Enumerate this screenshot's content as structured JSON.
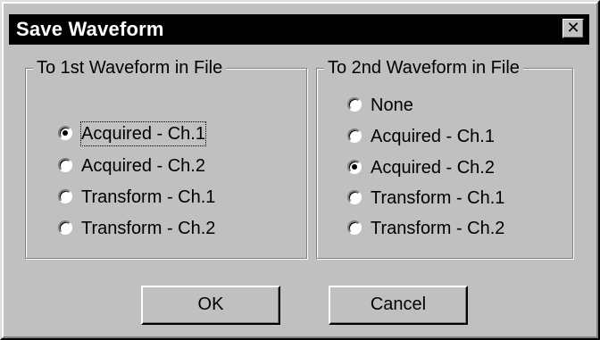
{
  "window": {
    "title": "Save Waveform",
    "close_glyph": "✕"
  },
  "group1": {
    "title": "To 1st Waveform in File",
    "options": [
      {
        "label": "Acquired - Ch.1",
        "checked": true,
        "focused": true
      },
      {
        "label": "Acquired - Ch.2",
        "checked": false
      },
      {
        "label": "Transform - Ch.1",
        "checked": false
      },
      {
        "label": "Transform - Ch.2",
        "checked": false
      }
    ]
  },
  "group2": {
    "title": "To 2nd Waveform in File",
    "options": [
      {
        "label": "None",
        "checked": false
      },
      {
        "label": "Acquired - Ch.1",
        "checked": false
      },
      {
        "label": "Acquired - Ch.2",
        "checked": true
      },
      {
        "label": "Transform - Ch.1",
        "checked": false
      },
      {
        "label": "Transform - Ch.2",
        "checked": false
      }
    ]
  },
  "buttons": {
    "ok_label": "OK",
    "cancel_label": "Cancel"
  },
  "colors": {
    "face": "#c0c0c0",
    "titlebar": "#000000",
    "title_text": "#ffffff"
  }
}
